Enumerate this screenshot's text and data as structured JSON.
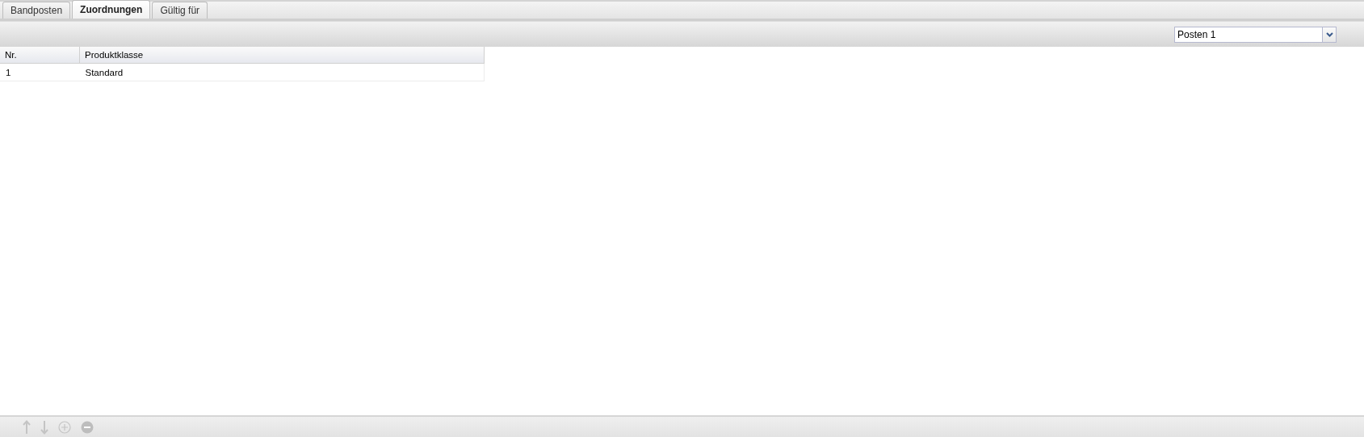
{
  "tabs": [
    {
      "label": "Bandposten",
      "selected": false
    },
    {
      "label": "Zuordnungen",
      "selected": true
    },
    {
      "label": "Gültig für",
      "selected": false
    }
  ],
  "posten_select": {
    "value": "Posten 1"
  },
  "table": {
    "columns": [
      "Nr.",
      "Produktklasse"
    ],
    "rows": [
      [
        "1",
        "Standard"
      ]
    ]
  },
  "bottom_toolbar": [
    {
      "kind": "up",
      "disabled": true
    },
    {
      "kind": "down",
      "disabled": true
    },
    {
      "kind": "add",
      "disabled": true
    },
    {
      "kind": "remove",
      "disabled": true
    }
  ]
}
